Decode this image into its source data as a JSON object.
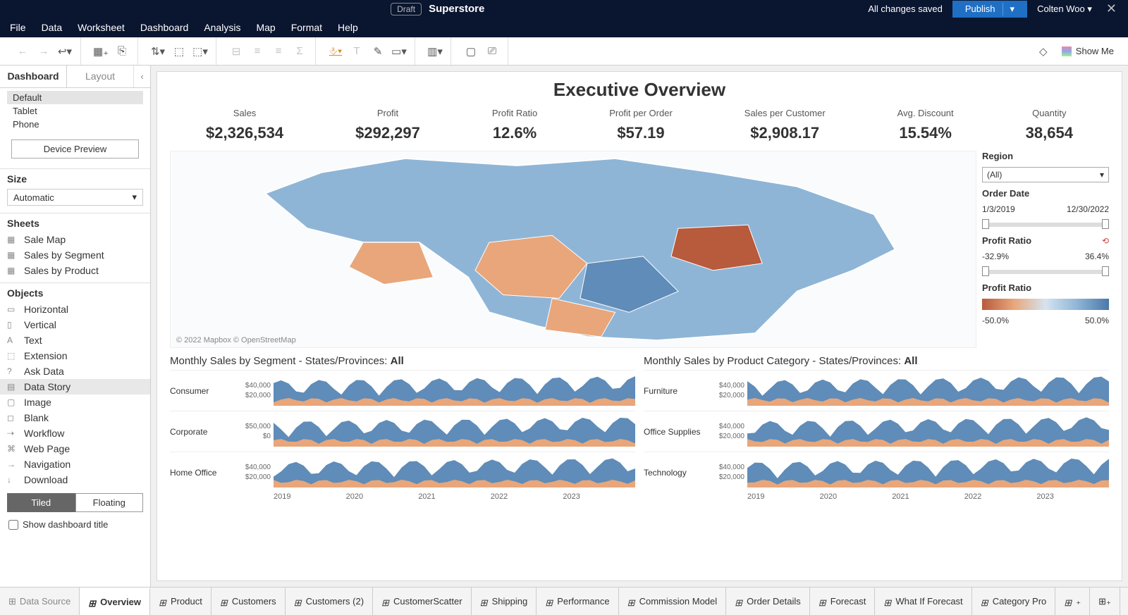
{
  "titlebar": {
    "draft": "Draft",
    "title": "Superstore",
    "saved": "All changes saved",
    "publish": "Publish",
    "user": "Colten Woo"
  },
  "menu": [
    "File",
    "Data",
    "Worksheet",
    "Dashboard",
    "Analysis",
    "Map",
    "Format",
    "Help"
  ],
  "showme": "Show Me",
  "side": {
    "tabs": {
      "dashboard": "Dashboard",
      "layout": "Layout"
    },
    "devices": [
      "Default",
      "Tablet",
      "Phone"
    ],
    "device_preview": "Device Preview",
    "size_head": "Size",
    "size_value": "Automatic",
    "sheets_head": "Sheets",
    "sheets": [
      "Sale Map",
      "Sales by Segment",
      "Sales by Product"
    ],
    "objects_head": "Objects",
    "objects": [
      "Horizontal",
      "Vertical",
      "Text",
      "Extension",
      "Ask Data",
      "Data Story",
      "Image",
      "Blank",
      "Workflow",
      "Web Page",
      "Navigation",
      "Download"
    ],
    "tiled": "Tiled",
    "floating": "Floating",
    "show_title": "Show dashboard title"
  },
  "dashboard": {
    "title": "Executive Overview",
    "kpis": [
      {
        "label": "Sales",
        "value": "$2,326,534"
      },
      {
        "label": "Profit",
        "value": "$292,297"
      },
      {
        "label": "Profit Ratio",
        "value": "12.6%"
      },
      {
        "label": "Profit per Order",
        "value": "$57.19"
      },
      {
        "label": "Sales per Customer",
        "value": "$2,908.17"
      },
      {
        "label": "Avg. Discount",
        "value": "15.54%"
      },
      {
        "label": "Quantity",
        "value": "38,654"
      }
    ],
    "map_attr": "© 2022 Mapbox   © OpenStreetMap",
    "filters": {
      "region_lbl": "Region",
      "region_val": "(All)",
      "orderdate_lbl": "Order Date",
      "orderdate_from": "1/3/2019",
      "orderdate_to": "12/30/2022",
      "profitratio_lbl": "Profit Ratio",
      "pr_from": "-32.9%",
      "pr_to": "36.4%",
      "legend_lbl": "Profit Ratio",
      "legend_from": "-50.0%",
      "legend_to": "50.0%"
    },
    "seg_title_prefix": "Monthly Sales by Segment - States/Provinces: ",
    "prod_title_prefix": "Monthly Sales by Product Category - States/Provinces: ",
    "all": "All",
    "segments": [
      {
        "name": "Consumer",
        "axis": [
          "$40,000",
          "$20,000"
        ]
      },
      {
        "name": "Corporate",
        "axis": [
          "$50,000",
          "$0"
        ]
      },
      {
        "name": "Home Office",
        "axis": [
          "$40,000",
          "$20,000"
        ]
      }
    ],
    "products": [
      {
        "name": "Furniture",
        "axis": [
          "$40,000",
          "$20,000"
        ]
      },
      {
        "name": "Office Supplies",
        "axis": [
          "$40,000",
          "$20,000"
        ]
      },
      {
        "name": "Technology",
        "axis": [
          "$40,000",
          "$20,000"
        ]
      }
    ],
    "years": [
      "2019",
      "2020",
      "2021",
      "2022",
      "2023"
    ]
  },
  "bottom_tabs": {
    "ds": "Data Source",
    "items": [
      "Overview",
      "Product",
      "Customers",
      "Customers (2)",
      "CustomerScatter",
      "Shipping",
      "Performance",
      "Commission Model",
      "Order Details",
      "Forecast",
      "What If Forecast",
      "Category Pro"
    ]
  },
  "chart_data": {
    "type": "area",
    "segments": {
      "x_years": [
        2019,
        2020,
        2021,
        2022,
        2023
      ],
      "series": [
        {
          "name": "Consumer",
          "ylim": [
            0,
            45000
          ]
        },
        {
          "name": "Corporate",
          "ylim": [
            0,
            55000
          ]
        },
        {
          "name": "Home Office",
          "ylim": [
            0,
            45000
          ]
        }
      ],
      "note": "stacked monthly area; blue over orange"
    },
    "products": {
      "x_years": [
        2019,
        2020,
        2021,
        2022,
        2023
      ],
      "series": [
        {
          "name": "Furniture",
          "ylim": [
            0,
            45000
          ]
        },
        {
          "name": "Office Supplies",
          "ylim": [
            0,
            45000
          ]
        },
        {
          "name": "Technology",
          "ylim": [
            0,
            45000
          ]
        }
      ]
    },
    "map": {
      "type": "choropleth",
      "region": "North America",
      "measure": "Profit Ratio",
      "range": [
        -0.5,
        0.5
      ]
    }
  }
}
